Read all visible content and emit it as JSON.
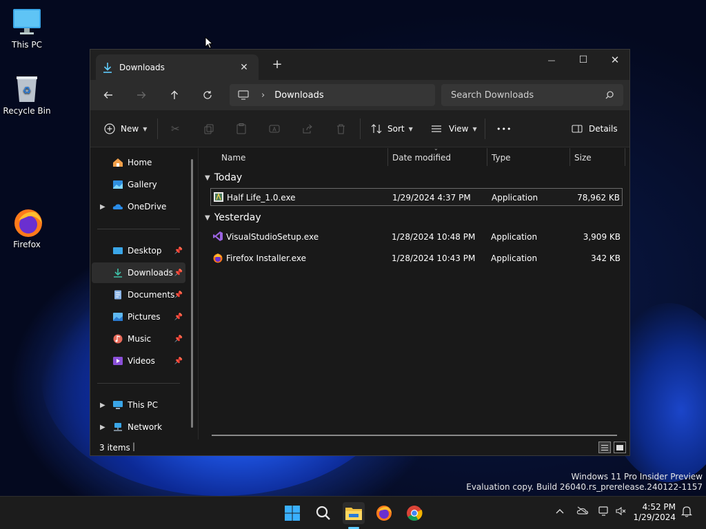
{
  "desktop": {
    "icons": [
      {
        "label": "This PC",
        "icon": "monitor-icon"
      },
      {
        "label": "Recycle Bin",
        "icon": "recycle-bin-icon"
      },
      {
        "label": "Firefox",
        "icon": "firefox-icon"
      }
    ],
    "watermark": {
      "line1": "Windows 11 Pro Insider Preview",
      "line2": "Evaluation copy. Build 26040.rs_prerelease.240122-1157"
    }
  },
  "window": {
    "tab": {
      "title": "Downloads",
      "close": "✕",
      "new_tab": "+"
    },
    "controls": {
      "minimize": "—",
      "maximize": "☐",
      "close": "✕"
    },
    "address": {
      "crumb": "Downloads",
      "separator": "›"
    },
    "search": {
      "placeholder": "Search Downloads"
    },
    "toolbar": {
      "new_label": "New",
      "sort_label": "Sort",
      "view_label": "View",
      "more_label": "•••",
      "details_label": "Details"
    },
    "sidebar": {
      "top": [
        {
          "label": "Home",
          "icon": "home-icon"
        },
        {
          "label": "Gallery",
          "icon": "gallery-icon"
        },
        {
          "label": "OneDrive",
          "icon": "onedrive-icon"
        }
      ],
      "quick": [
        {
          "label": "Desktop",
          "icon": "desktop-folder-icon"
        },
        {
          "label": "Downloads",
          "icon": "downloads-icon"
        },
        {
          "label": "Documents",
          "icon": "documents-icon"
        },
        {
          "label": "Pictures",
          "icon": "pictures-icon"
        },
        {
          "label": "Music",
          "icon": "music-icon"
        },
        {
          "label": "Videos",
          "icon": "videos-icon"
        }
      ],
      "bottom": [
        {
          "label": "This PC",
          "icon": "this-pc-icon"
        },
        {
          "label": "Network",
          "icon": "network-icon"
        }
      ]
    },
    "columns": {
      "name": "Name",
      "date": "Date modified",
      "type": "Type",
      "size": "Size"
    },
    "groups": [
      {
        "label": "Today",
        "files": [
          {
            "name": "Half Life_1.0.exe",
            "date": "1/29/2024 4:37 PM",
            "type": "Application",
            "size": "78,962 KB"
          }
        ]
      },
      {
        "label": "Yesterday",
        "files": [
          {
            "name": "VisualStudioSetup.exe",
            "date": "1/28/2024 10:48 PM",
            "type": "Application",
            "size": "3,909 KB"
          },
          {
            "name": "Firefox Installer.exe",
            "date": "1/28/2024 10:43 PM",
            "type": "Application",
            "size": "342 KB"
          }
        ]
      }
    ],
    "status": {
      "count": "3 items"
    }
  },
  "taskbar": {
    "time": "4:52 PM",
    "date": "1/29/2024"
  },
  "colors": {
    "accent": "#60cdff",
    "folder": "#f0c040",
    "selection_border": "#6b6b6b"
  }
}
